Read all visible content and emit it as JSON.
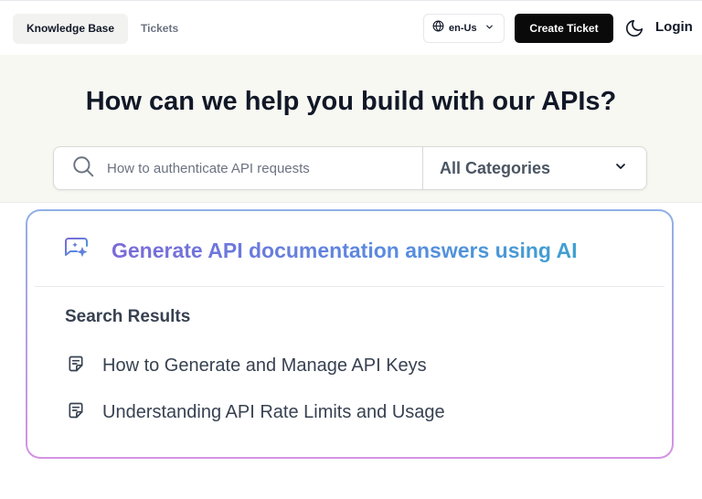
{
  "nav": {
    "tabs": [
      {
        "label": "Knowledge Base",
        "active": true
      },
      {
        "label": "Tickets",
        "active": false
      }
    ],
    "language": {
      "icon": "globe-icon",
      "value": "en-Us"
    },
    "create_ticket_label": "Create Ticket",
    "theme_icon": "moon-icon",
    "login_label": "Login"
  },
  "hero": {
    "title": "How can we help you build with our APIs?",
    "search": {
      "placeholder": "How to authenticate API requests",
      "value": ""
    },
    "category": {
      "selected": "All Categories"
    }
  },
  "results": {
    "ai_prompt": "Generate API documentation answers using AI",
    "section_title": "Search Results",
    "items": [
      {
        "title": "How to Generate and Manage API Keys",
        "icon": "document-icon"
      },
      {
        "title": "Understanding API Rate Limits and Usage",
        "icon": "document-icon"
      }
    ]
  },
  "colors": {
    "accent_start": "#7b6ad9",
    "accent_end": "#3fa0d0",
    "primary_button": "#0a0a0a",
    "hero_background": "#f8f8f3"
  }
}
